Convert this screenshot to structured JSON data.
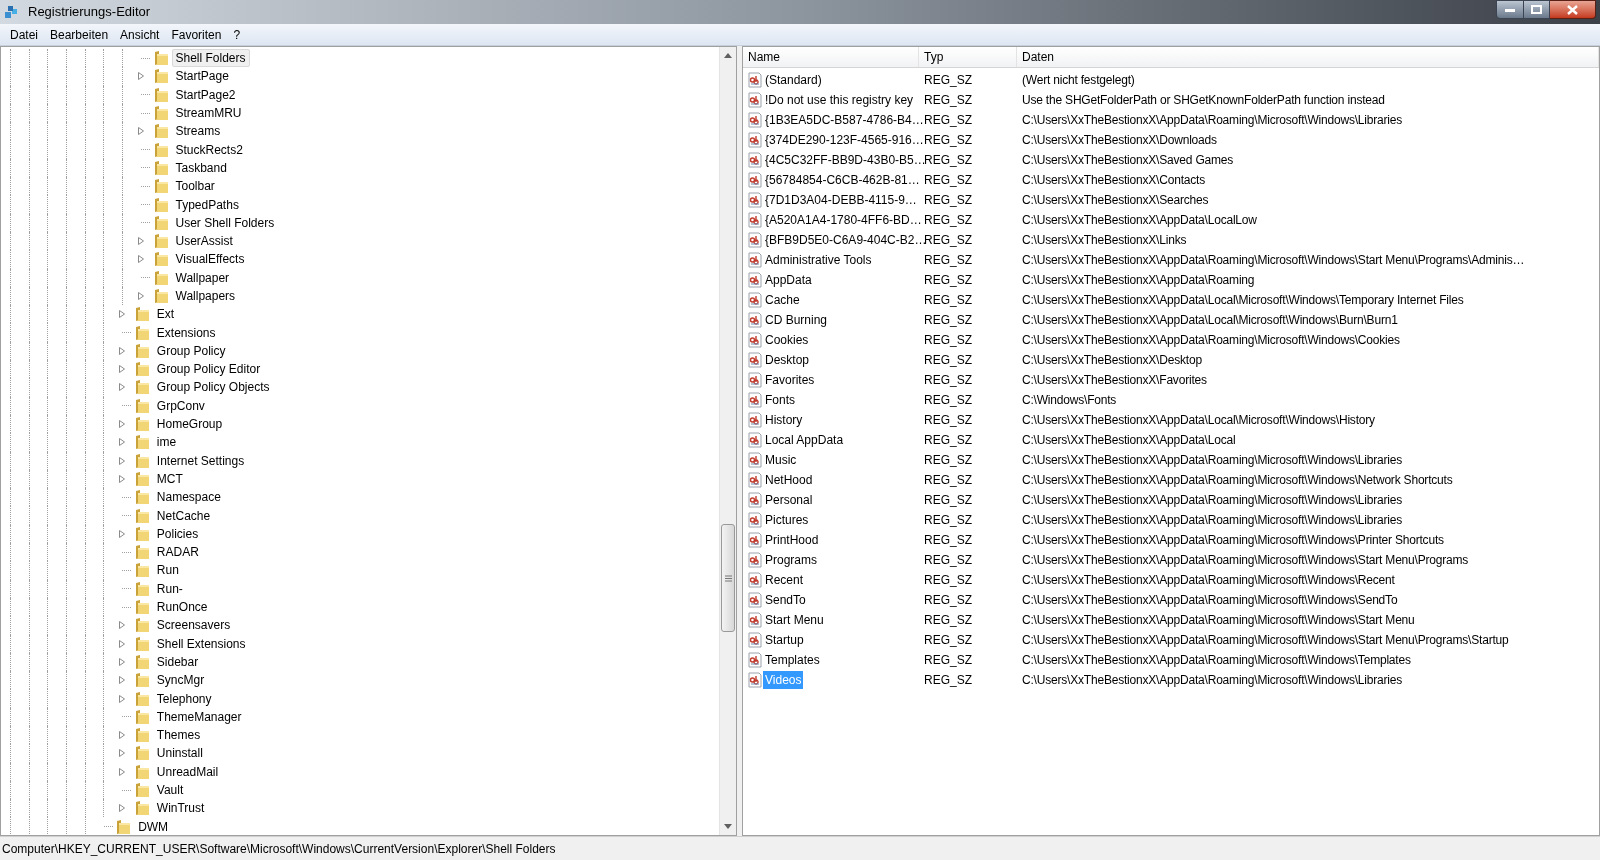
{
  "window": {
    "title": "Registrierungs-Editor"
  },
  "menu": [
    {
      "label": "Datei"
    },
    {
      "label": "Bearbeiten"
    },
    {
      "label": "Ansicht"
    },
    {
      "label": "Favoriten"
    },
    {
      "label": "?"
    }
  ],
  "tree": {
    "items": [
      {
        "children": [
          {
            "children": [
              {
                "label": "Shell Folders",
                "expandable": false,
                "selected": true
              },
              {
                "label": "StartPage",
                "expandable": true,
                "selected": false
              },
              {
                "label": "StartPage2",
                "expandable": false,
                "selected": false
              },
              {
                "label": "StreamMRU",
                "expandable": false,
                "selected": false
              },
              {
                "label": "Streams",
                "expandable": true,
                "selected": false
              },
              {
                "label": "StuckRects2",
                "expandable": false,
                "selected": false
              },
              {
                "label": "Taskband",
                "expandable": false,
                "selected": false
              },
              {
                "label": "Toolbar",
                "expandable": false,
                "selected": false
              },
              {
                "label": "TypedPaths",
                "expandable": false,
                "selected": false
              },
              {
                "label": "User Shell Folders",
                "expandable": false,
                "selected": false
              },
              {
                "label": "UserAssist",
                "expandable": true,
                "selected": false
              },
              {
                "label": "VisualEffects",
                "expandable": true,
                "selected": false
              },
              {
                "label": "Wallpaper",
                "expandable": false,
                "selected": false
              },
              {
                "label": "Wallpapers",
                "expandable": true,
                "selected": false
              }
            ]
          },
          {
            "label": "Ext",
            "expandable": true,
            "selected": false
          },
          {
            "label": "Extensions",
            "expandable": false,
            "selected": false
          },
          {
            "label": "Group Policy",
            "expandable": true,
            "selected": false
          },
          {
            "label": "Group Policy Editor",
            "expandable": true,
            "selected": false
          },
          {
            "label": "Group Policy Objects",
            "expandable": true,
            "selected": false
          },
          {
            "label": "GrpConv",
            "expandable": false,
            "selected": false
          },
          {
            "label": "HomeGroup",
            "expandable": true,
            "selected": false
          },
          {
            "label": "ime",
            "expandable": true,
            "selected": false
          },
          {
            "label": "Internet Settings",
            "expandable": true,
            "selected": false
          },
          {
            "label": "MCT",
            "expandable": true,
            "selected": false
          },
          {
            "label": "Namespace",
            "expandable": false,
            "selected": false
          },
          {
            "label": "NetCache",
            "expandable": false,
            "selected": false
          },
          {
            "label": "Policies",
            "expandable": true,
            "selected": false
          },
          {
            "label": "RADAR",
            "expandable": false,
            "selected": false
          },
          {
            "label": "Run",
            "expandable": false,
            "selected": false
          },
          {
            "label": "Run-",
            "expandable": false,
            "selected": false
          },
          {
            "label": "RunOnce",
            "expandable": false,
            "selected": false
          },
          {
            "label": "Screensavers",
            "expandable": true,
            "selected": false
          },
          {
            "label": "Shell Extensions",
            "expandable": true,
            "selected": false
          },
          {
            "label": "Sidebar",
            "expandable": true,
            "selected": false
          },
          {
            "label": "SyncMgr",
            "expandable": true,
            "selected": false
          },
          {
            "label": "Telephony",
            "expandable": true,
            "selected": false
          },
          {
            "label": "ThemeManager",
            "expandable": false,
            "selected": false
          },
          {
            "label": "Themes",
            "expandable": true,
            "selected": false
          },
          {
            "label": "Uninstall",
            "expandable": true,
            "selected": false
          },
          {
            "label": "UnreadMail",
            "expandable": true,
            "selected": false
          },
          {
            "label": "Vault",
            "expandable": false,
            "selected": false
          },
          {
            "label": "WinTrust",
            "expandable": true,
            "selected": false
          }
        ]
      },
      {
        "label": "DWM",
        "expandable": false,
        "selected": false
      }
    ]
  },
  "table": {
    "columns": [
      "Name",
      "Typ",
      "Daten"
    ],
    "rows": [
      {
        "name": "(Standard)",
        "type": "REG_SZ",
        "data": "(Wert nicht festgelegt)",
        "selected": false
      },
      {
        "name": "!Do not use this registry key",
        "type": "REG_SZ",
        "data": "Use the SHGetFolderPath or SHGetKnownFolderPath function instead",
        "selected": false
      },
      {
        "name": "{1B3EA5DC-B587-4786-B4…",
        "type": "REG_SZ",
        "data": "C:\\Users\\XxTheBestionxX\\AppData\\Roaming\\Microsoft\\Windows\\Libraries",
        "selected": false
      },
      {
        "name": "{374DE290-123F-4565-916…",
        "type": "REG_SZ",
        "data": "C:\\Users\\XxTheBestionxX\\Downloads",
        "selected": false
      },
      {
        "name": "{4C5C32FF-BB9D-43B0-B5…",
        "type": "REG_SZ",
        "data": "C:\\Users\\XxTheBestionxX\\Saved Games",
        "selected": false
      },
      {
        "name": "{56784854-C6CB-462B-81…",
        "type": "REG_SZ",
        "data": "C:\\Users\\XxTheBestionxX\\Contacts",
        "selected": false
      },
      {
        "name": "{7D1D3A04-DEBB-4115-9…",
        "type": "REG_SZ",
        "data": "C:\\Users\\XxTheBestionxX\\Searches",
        "selected": false
      },
      {
        "name": "{A520A1A4-1780-4FF6-BD…",
        "type": "REG_SZ",
        "data": "C:\\Users\\XxTheBestionxX\\AppData\\LocalLow",
        "selected": false
      },
      {
        "name": "{BFB9D5E0-C6A9-404C-B2…",
        "type": "REG_SZ",
        "data": "C:\\Users\\XxTheBestionxX\\Links",
        "selected": false
      },
      {
        "name": "Administrative Tools",
        "type": "REG_SZ",
        "data": "C:\\Users\\XxTheBestionxX\\AppData\\Roaming\\Microsoft\\Windows\\Start Menu\\Programs\\Adminis…",
        "selected": false
      },
      {
        "name": "AppData",
        "type": "REG_SZ",
        "data": "C:\\Users\\XxTheBestionxX\\AppData\\Roaming",
        "selected": false
      },
      {
        "name": "Cache",
        "type": "REG_SZ",
        "data": "C:\\Users\\XxTheBestionxX\\AppData\\Local\\Microsoft\\Windows\\Temporary Internet Files",
        "selected": false
      },
      {
        "name": "CD Burning",
        "type": "REG_SZ",
        "data": "C:\\Users\\XxTheBestionxX\\AppData\\Local\\Microsoft\\Windows\\Burn\\Burn1",
        "selected": false
      },
      {
        "name": "Cookies",
        "type": "REG_SZ",
        "data": "C:\\Users\\XxTheBestionxX\\AppData\\Roaming\\Microsoft\\Windows\\Cookies",
        "selected": false
      },
      {
        "name": "Desktop",
        "type": "REG_SZ",
        "data": "C:\\Users\\XxTheBestionxX\\Desktop",
        "selected": false
      },
      {
        "name": "Favorites",
        "type": "REG_SZ",
        "data": "C:\\Users\\XxTheBestionxX\\Favorites",
        "selected": false
      },
      {
        "name": "Fonts",
        "type": "REG_SZ",
        "data": "C:\\Windows\\Fonts",
        "selected": false
      },
      {
        "name": "History",
        "type": "REG_SZ",
        "data": "C:\\Users\\XxTheBestionxX\\AppData\\Local\\Microsoft\\Windows\\History",
        "selected": false
      },
      {
        "name": "Local AppData",
        "type": "REG_SZ",
        "data": "C:\\Users\\XxTheBestionxX\\AppData\\Local",
        "selected": false
      },
      {
        "name": "Music",
        "type": "REG_SZ",
        "data": "C:\\Users\\XxTheBestionxX\\AppData\\Roaming\\Microsoft\\Windows\\Libraries",
        "selected": false
      },
      {
        "name": "NetHood",
        "type": "REG_SZ",
        "data": "C:\\Users\\XxTheBestionxX\\AppData\\Roaming\\Microsoft\\Windows\\Network Shortcuts",
        "selected": false
      },
      {
        "name": "Personal",
        "type": "REG_SZ",
        "data": "C:\\Users\\XxTheBestionxX\\AppData\\Roaming\\Microsoft\\Windows\\Libraries",
        "selected": false
      },
      {
        "name": "Pictures",
        "type": "REG_SZ",
        "data": "C:\\Users\\XxTheBestionxX\\AppData\\Roaming\\Microsoft\\Windows\\Libraries",
        "selected": false
      },
      {
        "name": "PrintHood",
        "type": "REG_SZ",
        "data": "C:\\Users\\XxTheBestionxX\\AppData\\Roaming\\Microsoft\\Windows\\Printer Shortcuts",
        "selected": false
      },
      {
        "name": "Programs",
        "type": "REG_SZ",
        "data": "C:\\Users\\XxTheBestionxX\\AppData\\Roaming\\Microsoft\\Windows\\Start Menu\\Programs",
        "selected": false
      },
      {
        "name": "Recent",
        "type": "REG_SZ",
        "data": "C:\\Users\\XxTheBestionxX\\AppData\\Roaming\\Microsoft\\Windows\\Recent",
        "selected": false
      },
      {
        "name": "SendTo",
        "type": "REG_SZ",
        "data": "C:\\Users\\XxTheBestionxX\\AppData\\Roaming\\Microsoft\\Windows\\SendTo",
        "selected": false
      },
      {
        "name": "Start Menu",
        "type": "REG_SZ",
        "data": "C:\\Users\\XxTheBestionxX\\AppData\\Roaming\\Microsoft\\Windows\\Start Menu",
        "selected": false
      },
      {
        "name": "Startup",
        "type": "REG_SZ",
        "data": "C:\\Users\\XxTheBestionxX\\AppData\\Roaming\\Microsoft\\Windows\\Start Menu\\Programs\\Startup",
        "selected": false
      },
      {
        "name": "Templates",
        "type": "REG_SZ",
        "data": "C:\\Users\\XxTheBestionxX\\AppData\\Roaming\\Microsoft\\Windows\\Templates",
        "selected": false
      },
      {
        "name": "Videos",
        "type": "REG_SZ",
        "data": "C:\\Users\\XxTheBestionxX\\AppData\\Roaming\\Microsoft\\Windows\\Libraries",
        "selected": true
      }
    ]
  },
  "status_bar": {
    "path": "Computer\\HKEY_CURRENT_USER\\Software\\Microsoft\\Windows\\CurrentVersion\\Explorer\\Shell Folders"
  }
}
